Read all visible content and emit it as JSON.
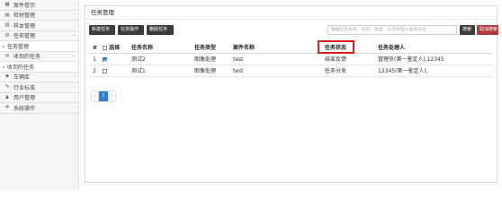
{
  "sidebar": {
    "items": [
      {
        "icon": "grid-icon",
        "glyph": "▦",
        "label": "案件卷宗",
        "chevron": "‹"
      },
      {
        "icon": "materials-icon",
        "glyph": "▤",
        "label": "检材管理",
        "chevron": "‹"
      },
      {
        "icon": "sample-icon",
        "glyph": "▥",
        "label": "样本管理",
        "chevron": "‹"
      },
      {
        "icon": "tasks-icon",
        "glyph": "⚙",
        "label": "任务管理",
        "chevron": "⌄"
      }
    ],
    "sub_task": "任务管理",
    "items2": [
      {
        "icon": "inbox-icon",
        "glyph": "✉",
        "label": "收到的任务",
        "chevron": "⌄"
      }
    ],
    "sub_received": "收到的任务",
    "items3": [
      {
        "icon": "vehicle-icon",
        "glyph": "⚑",
        "label": "车辆库",
        "chevron": "‹"
      },
      {
        "icon": "industry-icon",
        "glyph": "✎",
        "label": "行业标准",
        "chevron": "‹"
      },
      {
        "icon": "user-icon",
        "glyph": "♟",
        "label": "用户管理",
        "chevron": "‹"
      },
      {
        "icon": "settings-icon",
        "glyph": "✲",
        "label": "系统操作",
        "chevron": "‹"
      }
    ]
  },
  "main": {
    "title": "任务管理",
    "toolbar": {
      "new_task": "新建任务",
      "task_op": "任务操作",
      "delete_task": "删除任务",
      "search_placeholder": "根据任务名称、状态、类型、任务处理人查询任务",
      "search_btn": "搜索",
      "cancel_search_btn": "取消搜索"
    },
    "table": {
      "headers": {
        "no": "#",
        "select": "选择",
        "name": "任务名称",
        "type": "任务类型",
        "case": "案件名称",
        "status": "任务状态",
        "handler": "任务处理人"
      },
      "rows": [
        {
          "no": "1",
          "checked": true,
          "name": "测试2",
          "type": "图像处理",
          "case": "test",
          "status": "结束反馈",
          "handler": "管理员(第一鉴定人),12345"
        },
        {
          "no": "2",
          "checked": false,
          "name": "测试1",
          "type": "图像处理",
          "case": "test",
          "status": "任务分发",
          "handler": "12345(第一鉴定人),"
        }
      ]
    },
    "pagination": {
      "prev": "‹",
      "current": "1",
      "next": "›"
    }
  }
}
